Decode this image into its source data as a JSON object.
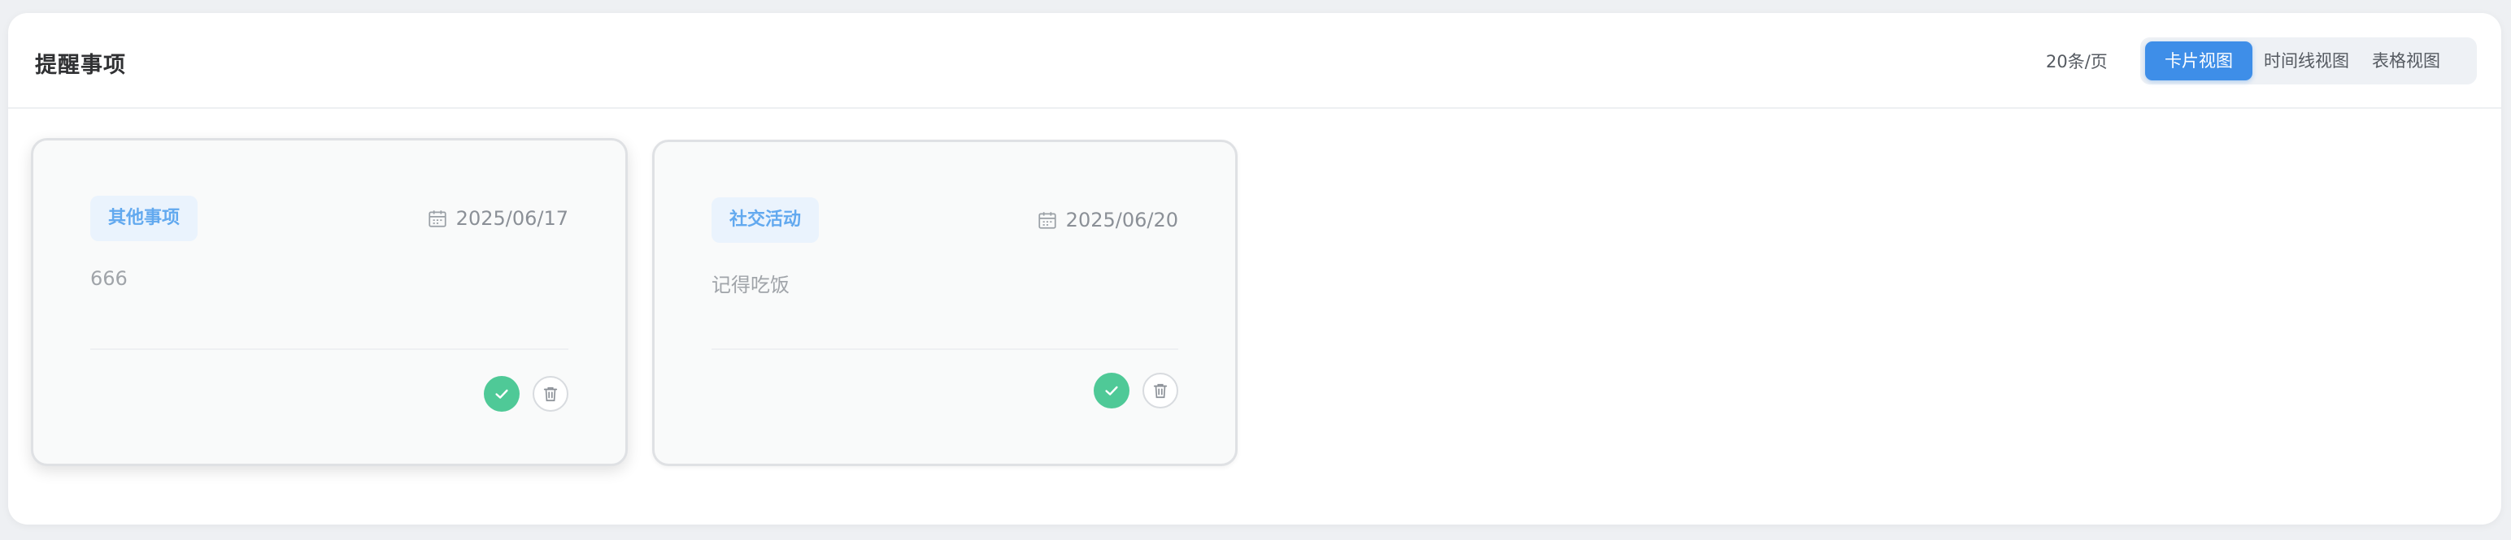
{
  "header": {
    "title": "提醒事项",
    "page_size": "20条/页",
    "views": [
      {
        "label": "卡片视图",
        "active": true
      },
      {
        "label": "时间线视图",
        "active": false
      },
      {
        "label": "表格视图",
        "active": false
      }
    ]
  },
  "cards": [
    {
      "category": "其他事项",
      "date": "2025/06/17",
      "content": "666"
    },
    {
      "category": "社交活动",
      "date": "2025/06/20",
      "content": "记得吃饭"
    }
  ],
  "icons": {
    "date": "calendar-icon",
    "complete": "check-icon",
    "delete": "trash-icon"
  },
  "colors": {
    "accent": "#3e8ee8",
    "tag_text": "#62a9ef",
    "tag_bg": "#eaf3fd",
    "done": "#4fc997"
  }
}
